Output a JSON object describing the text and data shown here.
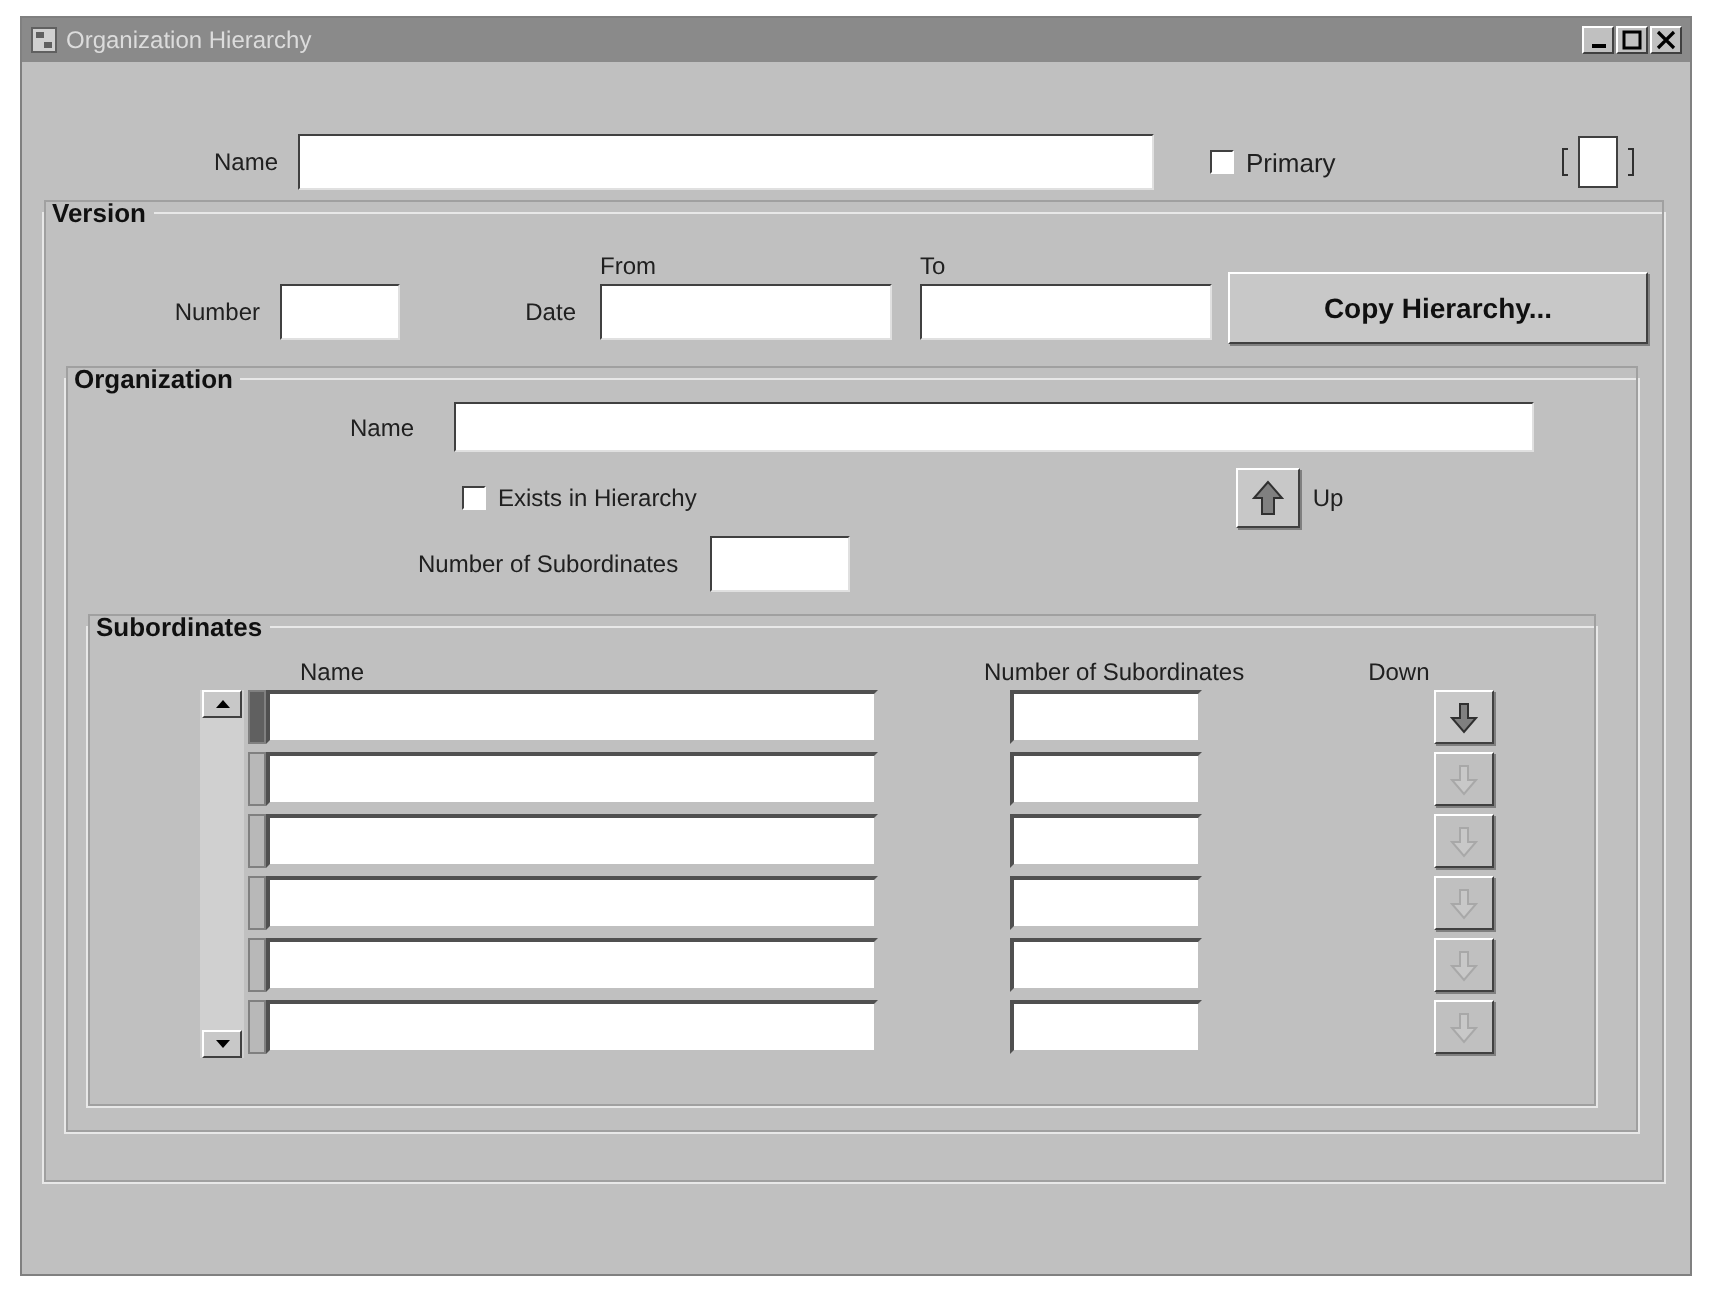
{
  "window": {
    "title": "Organization Hierarchy"
  },
  "header": {
    "name_label": "Name",
    "primary": {
      "label": "Primary",
      "checked": false
    }
  },
  "version": {
    "title": "Version",
    "number_label": "Number",
    "date_label": "Date",
    "from_label": "From",
    "to_label": "To",
    "copy_button": "Copy Hierarchy..."
  },
  "organization": {
    "title": "Organization",
    "name_label": "Name",
    "exists": {
      "label": "Exists in Hierarchy",
      "checked": false
    },
    "up_button": "Up",
    "subordinates_label": "Number of Subordinates"
  },
  "subordinates": {
    "title": "Subordinates",
    "columns": [
      "Name",
      "Number of Subordinates",
      "Down"
    ],
    "rows": [
      {
        "selected": true,
        "down_disabled": false
      },
      {
        "selected": false,
        "down_disabled": true
      },
      {
        "selected": false,
        "down_disabled": true
      },
      {
        "selected": false,
        "down_disabled": true
      },
      {
        "selected": false,
        "down_disabled": true
      },
      {
        "selected": false,
        "down_disabled": true
      }
    ]
  }
}
